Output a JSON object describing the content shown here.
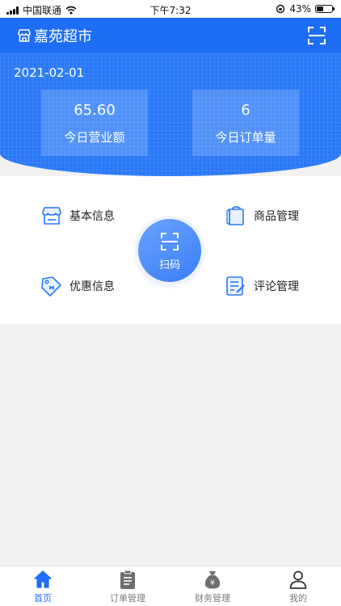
{
  "status_bar": {
    "carrier": "中国联通",
    "time": "下午7:32",
    "battery": "43%",
    "battery_level": 0.43
  },
  "header": {
    "title": "嘉苑超市",
    "icons": {
      "store": "store-icon",
      "scan": "scan-icon"
    }
  },
  "banner": {
    "date": "2021-02-01",
    "sales": {
      "value": "65.60",
      "label": "今日营业额"
    },
    "orders": {
      "value": "6",
      "label": "今日订单量"
    }
  },
  "menu": {
    "basic_info": {
      "label": "基本信息",
      "icon": "store-icon"
    },
    "goods": {
      "label": "商品管理",
      "icon": "shopping-bag-icon"
    },
    "promotions": {
      "label": "优惠信息",
      "icon": "discount-tag-icon"
    },
    "reviews": {
      "label": "评论管理",
      "icon": "edit-document-icon"
    },
    "scan": {
      "label": "扫码",
      "icon": "scan-icon"
    }
  },
  "tabbar": {
    "tabs": [
      {
        "label": "首页",
        "icon": "home-icon",
        "active": true
      },
      {
        "label": "订单管理",
        "icon": "clipboard-icon",
        "active": false
      },
      {
        "label": "财务管理",
        "icon": "money-bag-icon",
        "active": false
      },
      {
        "label": "我的",
        "icon": "person-icon",
        "active": false
      }
    ]
  },
  "colors": {
    "primary": "#1e6ef5",
    "banner": "#2a79f7",
    "tab_inactive": "#7a7a7a",
    "background": "#f2f2f2"
  }
}
